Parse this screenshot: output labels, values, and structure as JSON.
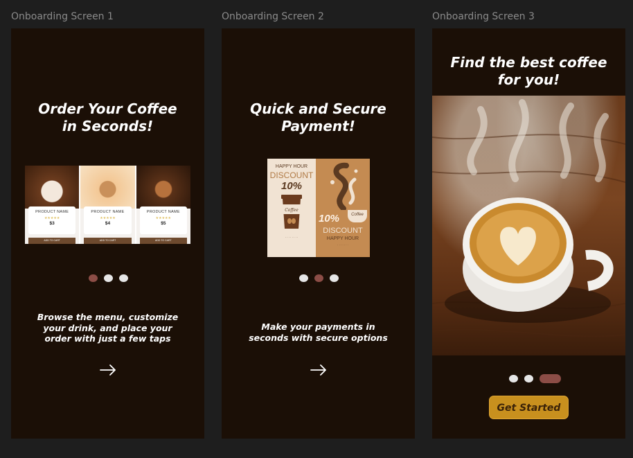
{
  "frames": [
    {
      "label": "Onboarding Screen 1",
      "title": [
        "Order Your Coffee",
        "in Seconds!"
      ],
      "products": [
        {
          "name": "PRODUCT NAME",
          "stars": "★★★★★",
          "price": "$3",
          "button": "ADD TO CART"
        },
        {
          "name": "PRODUCT NAME",
          "stars": "★★★★★",
          "price": "$4",
          "button": "ADD TO CART"
        },
        {
          "name": "PRODUCT NAME",
          "stars": "★★★★★",
          "price": "$5",
          "button": "ADD TO CART"
        }
      ],
      "description": [
        "Browse the menu, customize",
        "your drink, and place your",
        "order with just a few taps"
      ],
      "next_icon": "arrow-right-icon"
    },
    {
      "label": "Onboarding Screen 2",
      "title": [
        "Quick and Secure",
        "Payment!"
      ],
      "flyer": {
        "left_heading": "HAPPY HOUR",
        "left_discount": "DISCOUNT",
        "left_percent": "10%",
        "cup_label": "Coffee",
        "right_percent": "10%",
        "right_discount": "DISCOUNT",
        "right_heading": "HAPPY HOUR",
        "cup_tag": "Coffee"
      },
      "description": [
        "Make your payments in",
        "seconds with secure options"
      ],
      "next_icon": "arrow-right-icon"
    },
    {
      "label": "Onboarding Screen 3",
      "title": [
        "Find the best coffee",
        "for you!"
      ],
      "cta_label": "Get Started"
    }
  ],
  "colors": {
    "canvas": "#1e1e1e",
    "screen_bg": "#1b0f06",
    "dot_active": "#8c4d46",
    "dot_inactive": "#e6e6e6",
    "cta": "#c8901e"
  }
}
